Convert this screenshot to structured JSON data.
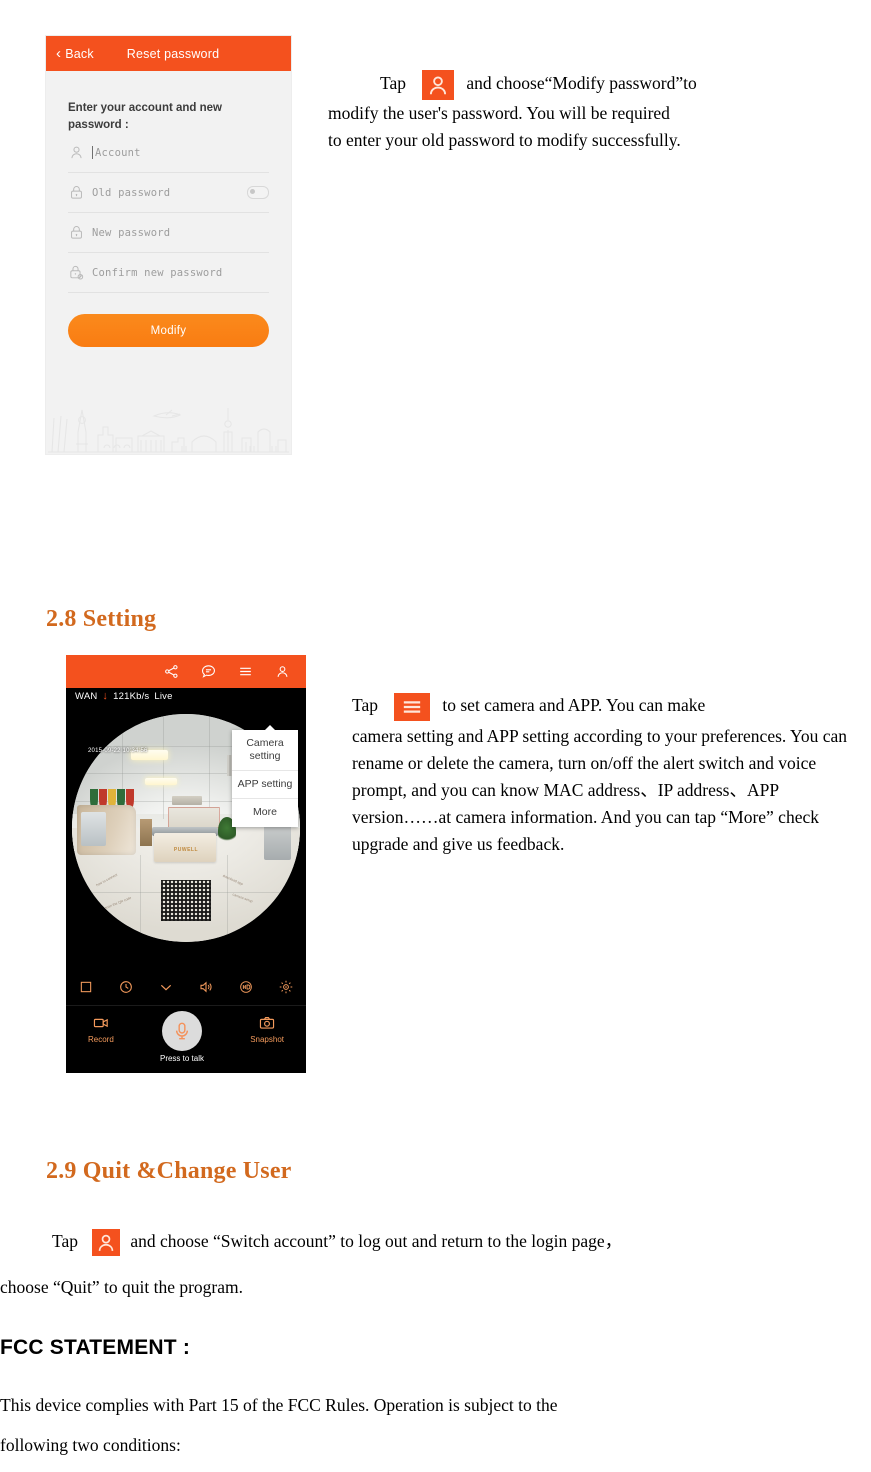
{
  "phone_reset": {
    "topbar": {
      "back_label": "Back",
      "title": "Reset password"
    },
    "prompt": "Enter your account and new password :",
    "fields": [
      {
        "label": "Account",
        "icon": "person-icon"
      },
      {
        "label": "Old password",
        "icon": "lock-icon"
      },
      {
        "label": "New password",
        "icon": "lock-icon"
      },
      {
        "label": "Confirm new password",
        "icon": "lock-check-icon"
      }
    ],
    "submit_label": "Modify"
  },
  "phone_live": {
    "topbar_icons": [
      "share-icon",
      "chat-icon",
      "hamburger-menu-icon",
      "person-icon"
    ],
    "status": {
      "network": "WAN",
      "arrow": "↓",
      "speed": "121Kb/s",
      "mode": "Live"
    },
    "timestamp": "2015-09-22 10:34:56",
    "desk_logo": "PUWELL",
    "menu": {
      "items": [
        "Camera setting",
        "APP setting",
        "More"
      ]
    },
    "control_icons": [
      "stop-square-icon",
      "clock-icon",
      "chevron-down-icon",
      "speaker-icon",
      "hd-icon",
      "brightness-icon"
    ],
    "actions": {
      "record_label": "Record",
      "talk_label": "Press to talk",
      "snapshot_label": "Snapshot"
    }
  },
  "doc": {
    "para_reset": {
      "lead": "Tap",
      "icon": "person-icon-badge",
      "rest_line1": "and choose“Modify password”to",
      "line2": "modify the user's password. You will be required",
      "line3": "to enter your old password to modify successfully."
    },
    "heading_28": "2.8 Setting",
    "para_setting": {
      "lead": "Tap",
      "icon": "hamburger-menu-icon-badge",
      "rest_line1": "to set camera and APP. You can make",
      "body": "camera setting and APP setting according to your preferences. You can rename or delete the camera, turn on/off the alert switch and voice prompt, and you can know MAC address、IP address、APP version……at camera information. And you can tap “More” check upgrade and give us feedback."
    },
    "heading_29": "2.9 Quit &Change User",
    "para_quit": {
      "lead": "Tap",
      "icon": "person-icon-badge",
      "rest_line1": "and choose “Switch account” to log out and return to the login page，",
      "line2": "choose “Quit” to quit the program."
    },
    "fcc_title": "FCC STATEMENT :",
    "fcc_line1": "This device complies with Part 15 of the FCC Rules. Operation is subject to the",
    "fcc_line2": "following two conditions:"
  },
  "colors": {
    "accent_orange": "#F4511E",
    "heading_orange": "#D2691E",
    "button_orange": "#FB8C00"
  }
}
